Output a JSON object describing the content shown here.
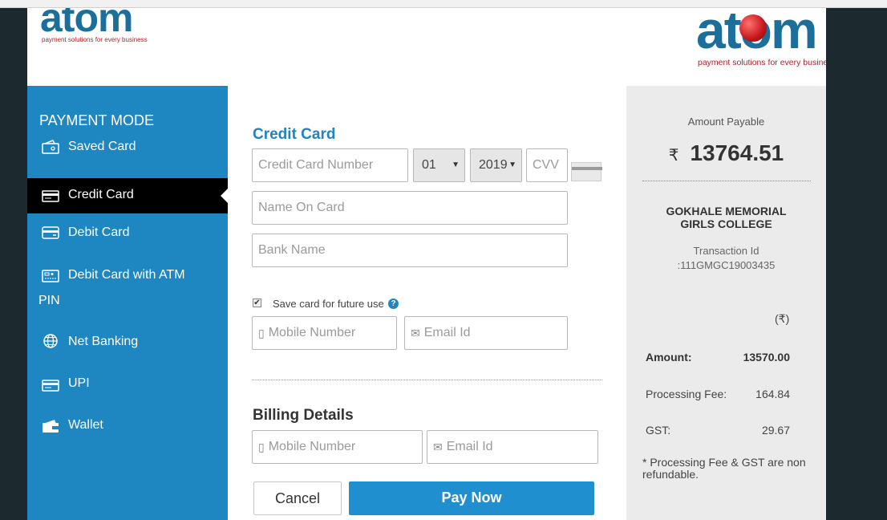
{
  "logo_small": {
    "word": "atom",
    "tagline": "payment solutions for every business"
  },
  "logo_big": {
    "word": "atom",
    "tagline": "payment solutions for every business"
  },
  "sidebar": {
    "heading": "PAYMENT MODE",
    "items": [
      {
        "label": "Saved Card",
        "icon": "wallet-card-icon"
      },
      {
        "label": "Credit Card",
        "icon": "credit-card-icon",
        "active": true
      },
      {
        "label": "Debit Card",
        "icon": "debit-card-icon"
      },
      {
        "label": "Debit Card with ATM",
        "label2": "PIN",
        "icon": "atm-pin-card-icon"
      },
      {
        "label": "Net Banking",
        "icon": "globe-icon"
      },
      {
        "label": "UPI",
        "icon": "upi-card-icon"
      },
      {
        "label": "Wallet",
        "icon": "wallet-icon"
      }
    ]
  },
  "form": {
    "title": "Credit Card",
    "card_number_placeholder": "Credit Card Number",
    "month_value": "01",
    "year_value": "2019",
    "cvv_placeholder": "CVV",
    "name_placeholder": "Name On Card",
    "bank_placeholder": "Bank Name",
    "save_card_label": "Save card for future use",
    "save_card_checked": true,
    "mobile_placeholder": "Mobile Number",
    "email_placeholder": "Email Id",
    "billing_title": "Billing Details",
    "billing_mobile_placeholder": "Mobile Number",
    "billing_email_placeholder": "Email Id",
    "cancel_label": "Cancel",
    "pay_label": "Pay Now"
  },
  "summary": {
    "amount_payable_label": "Amount Payable",
    "currency_symbol": "₹",
    "amount_payable": "13764.51",
    "college_line1": "GOKHALE MEMORIAL",
    "college_line2": "GIRLS COLLEGE",
    "transaction_label": "Transaction Id",
    "transaction_id": ":111GMGC19003435",
    "currency_header": "(₹)",
    "amount_label": "Amount:",
    "amount_value": "13570.00",
    "fee_label": "Processing Fee:",
    "fee_value": "164.84",
    "gst_label": "GST:",
    "gst_value": "29.67",
    "note": "* Processing Fee & GST are non refundable."
  },
  "colors": {
    "brand_blue": "#1e87c2",
    "pay_button": "#1f8fcf",
    "brand_red": "#b2232b",
    "active_item": "#000000"
  }
}
